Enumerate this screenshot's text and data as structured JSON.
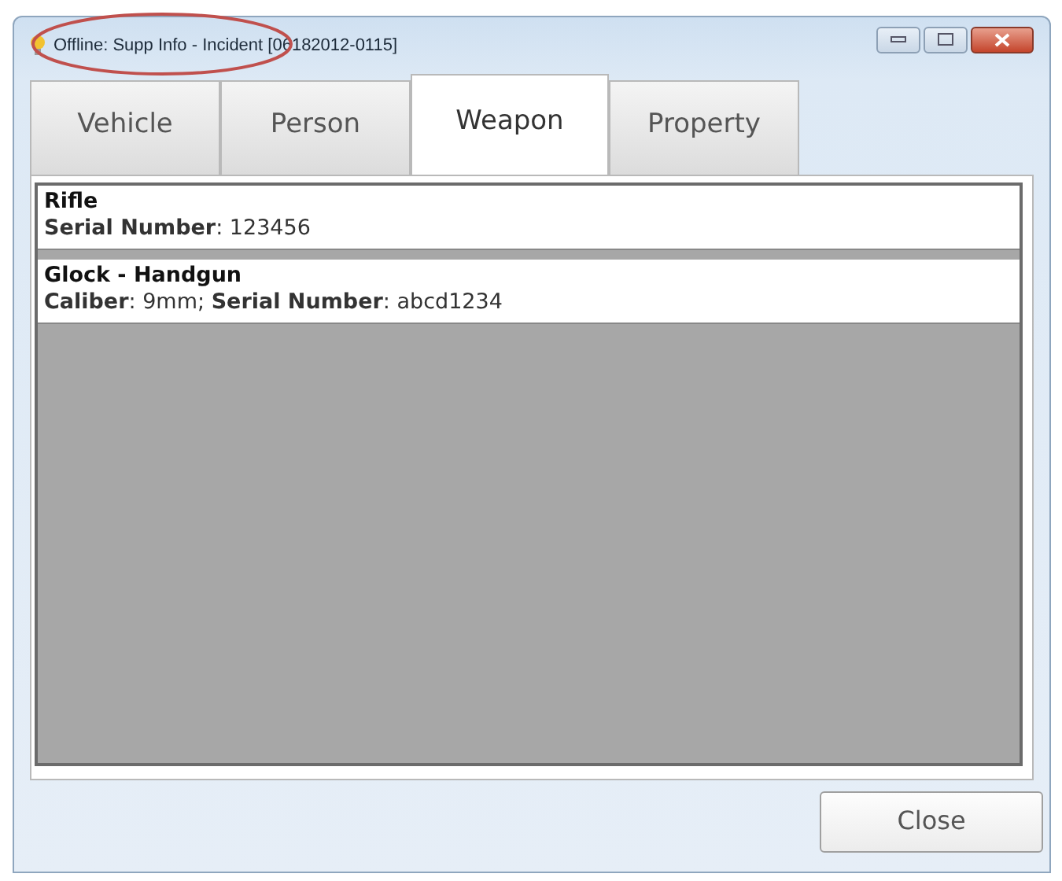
{
  "window": {
    "title": "Offline: Supp Info - Incident [06182012-0115]"
  },
  "tabs": [
    {
      "label": "Vehicle",
      "selected": false
    },
    {
      "label": "Person",
      "selected": false
    },
    {
      "label": "Weapon",
      "selected": true
    },
    {
      "label": "Property",
      "selected": false
    }
  ],
  "items": [
    {
      "title": "Rifle",
      "details": "**Serial Number**: 123456"
    },
    {
      "title": "Glock - Handgun",
      "details": "**Caliber**: 9mm; **Serial Number**: abcd1234"
    }
  ],
  "buttons": [
    {
      "label": "Close"
    }
  ]
}
